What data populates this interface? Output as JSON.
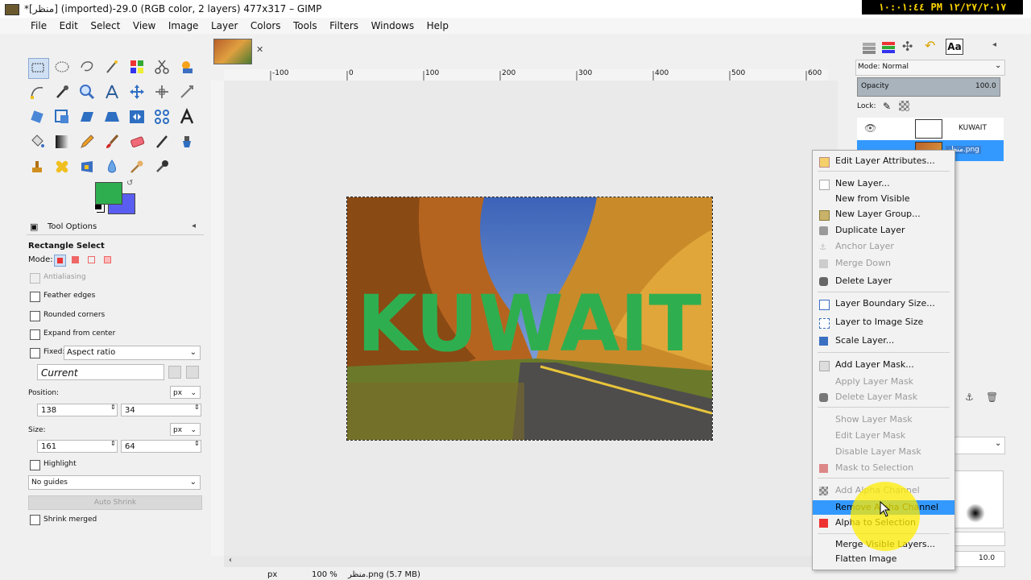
{
  "window": {
    "title": "*[منظر] (imported)-29.0 (RGB color, 2 layers) 477x317 – GIMP",
    "clock": "١٠:٠١:٤٤ PM ١٢/٢٧/٢٠١٧"
  },
  "menu": [
    "File",
    "Edit",
    "Select",
    "View",
    "Image",
    "Layer",
    "Colors",
    "Tools",
    "Filters",
    "Windows",
    "Help"
  ],
  "tool_options": {
    "tab_label": "Tool Options",
    "tool_name": "Rectangle Select",
    "mode_label": "Mode:",
    "antialiasing": "Antialiasing",
    "feather_edges": "Feather edges",
    "rounded_corners": "Rounded corners",
    "expand_from_center": "Expand from center",
    "fixed_label": "Fixed:",
    "fixed_value": "Aspect ratio",
    "current": "Current",
    "position_label": "Position:",
    "position_unit": "px",
    "position_x": "138",
    "position_y": "34",
    "size_label": "Size:",
    "size_unit": "px",
    "size_w": "161",
    "size_h": "64",
    "highlight": "Highlight",
    "guides": "No guides",
    "auto_shrink": "Auto Shrink",
    "shrink_merged": "Shrink merged"
  },
  "rulers": {
    "top": [
      "-100",
      "0",
      "100",
      "200",
      "300",
      "400",
      "500",
      "600"
    ]
  },
  "image": {
    "overlay_text": "KUWAIT",
    "overlay_color": "#2fae4f"
  },
  "statusbar": {
    "unit": "px",
    "zoom": "100 %",
    "info": "منظر.png (5.7 MB)"
  },
  "layers_dock": {
    "mode_label": "Mode: Normal",
    "opacity_label": "Opacity",
    "opacity_value": "100.0",
    "lock_label": "Lock:",
    "layer1_name": "KUWAIT",
    "layer2_name": "منظر.png",
    "brush_size": "10.0"
  },
  "context_menu": [
    {
      "label": "Edit Layer Attributes...",
      "disabled": false,
      "icon": "edit-icon"
    },
    {
      "label": "New Layer...",
      "disabled": false,
      "icon": "page-icon"
    },
    {
      "label": "New from Visible",
      "disabled": false,
      "icon": ""
    },
    {
      "label": "New Layer Group...",
      "disabled": false,
      "icon": "folder-icon"
    },
    {
      "label": "Duplicate Layer",
      "disabled": false,
      "icon": "duplicate-icon"
    },
    {
      "label": "Anchor Layer",
      "disabled": true,
      "icon": "anchor-icon"
    },
    {
      "label": "Merge Down",
      "disabled": true,
      "icon": "merge-icon"
    },
    {
      "label": "Delete Layer",
      "disabled": false,
      "icon": "delete-icon"
    },
    {
      "label": "Layer Boundary Size...",
      "disabled": false,
      "icon": "boundary-icon"
    },
    {
      "label": "Layer to Image Size",
      "disabled": false,
      "icon": "resize-icon"
    },
    {
      "label": "Scale Layer...",
      "disabled": false,
      "icon": "scale-icon"
    },
    {
      "label": "Add Layer Mask...",
      "disabled": false,
      "icon": "mask-icon"
    },
    {
      "label": "Apply Layer Mask",
      "disabled": true,
      "icon": ""
    },
    {
      "label": "Delete Layer Mask",
      "disabled": true,
      "icon": "delete-icon"
    },
    {
      "label": "Show Layer Mask",
      "disabled": true,
      "icon": ""
    },
    {
      "label": "Edit Layer Mask",
      "disabled": true,
      "icon": ""
    },
    {
      "label": "Disable Layer Mask",
      "disabled": true,
      "icon": ""
    },
    {
      "label": "Mask to Selection",
      "disabled": true,
      "icon": "selection-icon"
    },
    {
      "label": "Add Alpha Channel",
      "disabled": true,
      "icon": "alpha-icon"
    },
    {
      "label": "Remove Alpha Channel",
      "disabled": false,
      "icon": "",
      "highlighted": true
    },
    {
      "label": "Alpha to Selection",
      "disabled": false,
      "icon": "selection-icon"
    },
    {
      "label": "Merge Visible Layers...",
      "disabled": false,
      "icon": ""
    },
    {
      "label": "Flatten Image",
      "disabled": false,
      "icon": ""
    }
  ]
}
